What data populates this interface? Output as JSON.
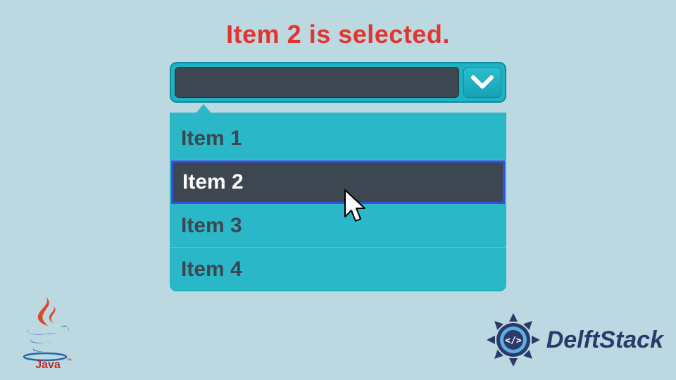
{
  "heading": "Item 2 is selected.",
  "combo": {
    "value": "",
    "options": [
      {
        "label": "Item 1",
        "selected": false
      },
      {
        "label": "Item 2",
        "selected": true
      },
      {
        "label": "Item 3",
        "selected": false
      },
      {
        "label": "Item 4",
        "selected": false
      }
    ]
  },
  "logos": {
    "java": "Java",
    "delftstack": "DelftStack"
  },
  "colors": {
    "background": "#bcd8e0",
    "accent_teal": "#2ab8c9",
    "dark_field": "#3d4751",
    "heading_red": "#e2342e",
    "selection_border": "#3a4ee0",
    "brand_blue": "#2a3a6a"
  }
}
